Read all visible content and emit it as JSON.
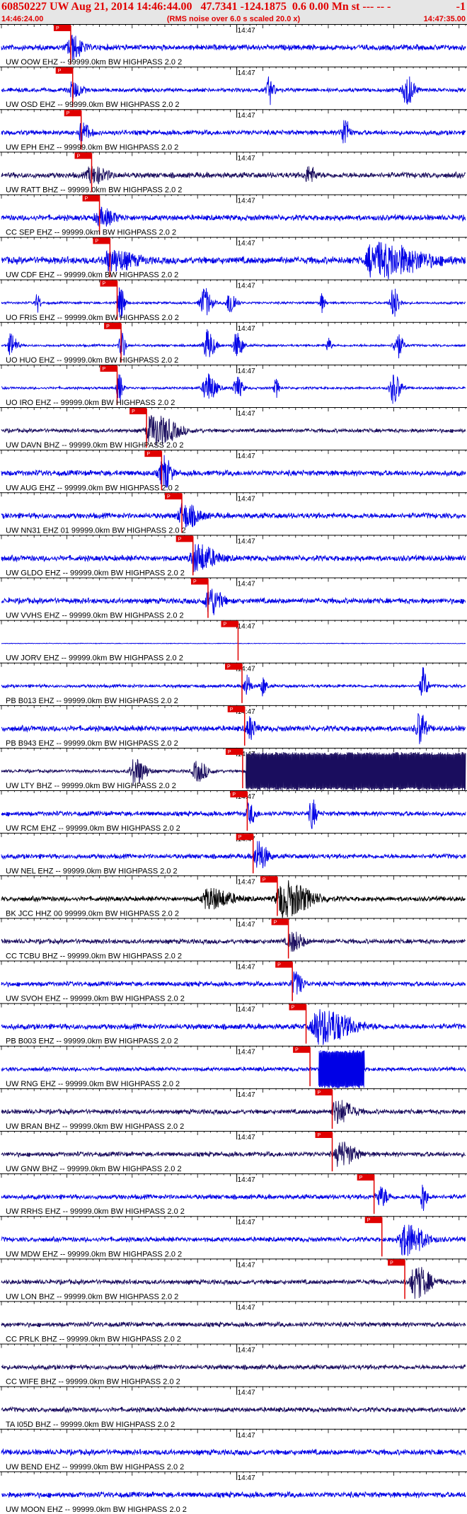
{
  "header": {
    "title": "60850227 UW Aug 21, 2014 14:46:44.00   47.7341 -124.1875  0.6 0.00 Mn st --- -- -",
    "title_right": "-1",
    "start_time": "14:46:24.00",
    "subtitle": "(RMS noise over 6.0 s scaled 20.0 x)",
    "end_time": "14:47:35.00"
  },
  "colors": {
    "trace_blue": "#0000e6",
    "trace_dark": "#1a0d5e",
    "trace_black": "#000000",
    "pick_red": "#e00000",
    "header_bg": "#e6e6e6"
  },
  "chart_data": {
    "type": "line",
    "description_kind": "seismogram record section",
    "time_start": "14:46:24.00",
    "time_end": "14:47:35.00",
    "time_range_s": [
      0,
      71
    ],
    "minute_tick_label": "14:47",
    "minute_tick_time_s": 36,
    "pick_label": "P",
    "traces": [
      {
        "label": "UW OOW EHZ -- 99999.0km BW  HIGHPASS  2.0  2",
        "pick_s": 10.6,
        "color": "blue",
        "energy": 0.35,
        "bursts": [
          [
            10.8,
            1.4,
            0.6
          ]
        ]
      },
      {
        "label": "UW OSD EHZ -- 99999.0km BW  HIGHPASS  2.0  2",
        "pick_s": 10.9,
        "color": "blue",
        "energy": 0.25,
        "bursts": [
          [
            11.0,
            1.2,
            0.4
          ],
          [
            41.0,
            0.6,
            0.7
          ],
          [
            62.0,
            1.0,
            0.8
          ]
        ]
      },
      {
        "label": "UW EPH EHZ -- 99999.0km BW  HIGHPASS  2.0  2",
        "pick_s": 12.2,
        "color": "blue",
        "energy": 0.3,
        "bursts": [
          [
            12.4,
            1.0,
            0.5
          ],
          [
            52.5,
            0.6,
            0.9
          ]
        ]
      },
      {
        "label": "UW RATT BHZ -- 99999.0km BW  HIGHPASS  2.0  2",
        "pick_s": 13.8,
        "color": "dark",
        "energy": 0.35,
        "bursts": [
          [
            14.0,
            2.0,
            0.4
          ],
          [
            47.0,
            1.0,
            0.4
          ]
        ]
      },
      {
        "label": "CC SEP EHZ -- 99999.0km BW  HIGHPASS  2.0  2",
        "pick_s": 15.0,
        "color": "blue",
        "energy": 0.35,
        "bursts": [
          [
            15.3,
            2.0,
            0.4
          ]
        ]
      },
      {
        "label": "UW CDF EHZ -- 99999.0km BW  HIGHPASS  2.0  2",
        "pick_s": 16.6,
        "color": "blue",
        "energy": 0.45,
        "bursts": [
          [
            17.0,
            3.0,
            0.5
          ],
          [
            58.0,
            6.0,
            0.8
          ]
        ]
      },
      {
        "label": "UO FRIS EHZ -- 99999.0km BW  HIGHPASS  2.0  2",
        "pick_s": 17.7,
        "color": "blue",
        "energy": 0.15,
        "bursts": [
          [
            5.5,
            0.4,
            0.5
          ],
          [
            18.2,
            0.6,
            0.9
          ],
          [
            31.0,
            1.0,
            0.8
          ],
          [
            35.0,
            0.8,
            0.7
          ],
          [
            49.0,
            0.4,
            0.5
          ],
          [
            60.0,
            0.8,
            0.8
          ]
        ]
      },
      {
        "label": "UO HUO EHZ -- 99999.0km BW  HIGHPASS  2.0  2",
        "pick_s": 18.3,
        "color": "blue",
        "energy": 0.15,
        "bursts": [
          [
            1.5,
            0.8,
            0.6
          ],
          [
            18.4,
            0.5,
            0.8
          ],
          [
            31.5,
            1.0,
            0.8
          ],
          [
            36.0,
            0.8,
            0.7
          ],
          [
            50.0,
            0.4,
            0.4
          ],
          [
            60.5,
            0.8,
            0.7
          ]
        ]
      },
      {
        "label": "UO IRO EHZ -- 99999.0km BW  HIGHPASS  2.0  2",
        "pick_s": 17.7,
        "color": "blue",
        "energy": 0.15,
        "bursts": [
          [
            18.0,
            0.5,
            0.8
          ],
          [
            31.5,
            1.2,
            0.8
          ],
          [
            36.0,
            0.8,
            0.6
          ],
          [
            42.0,
            0.4,
            0.5
          ],
          [
            60.0,
            1.0,
            0.8
          ]
        ]
      },
      {
        "label": "UW DAVN BHZ -- 99999.0km BW  HIGHPASS  2.0  2",
        "pick_s": 22.2,
        "color": "dark",
        "energy": 0.25,
        "bursts": [
          [
            23.5,
            3.0,
            0.8
          ]
        ]
      },
      {
        "label": "UW AUG EHZ -- 99999.0km BW  HIGHPASS  2.0  2",
        "pick_s": 24.5,
        "color": "blue",
        "energy": 0.35,
        "bursts": [
          [
            24.8,
            1.0,
            0.9
          ]
        ]
      },
      {
        "label": "UW NN31 EHZ 01 99999.0km BW  HIGHPASS  2.0  2",
        "pick_s": 27.6,
        "color": "blue",
        "energy": 0.35,
        "bursts": [
          [
            28.0,
            2.0,
            0.6
          ]
        ]
      },
      {
        "label": "UW GLDO EHZ -- 99999.0km BW  HIGHPASS  2.0  2",
        "pick_s": 29.3,
        "color": "blue",
        "energy": 0.35,
        "bursts": [
          [
            30.0,
            2.5,
            0.7
          ]
        ]
      },
      {
        "label": "UW VVHS EHZ -- 99999.0km BW  HIGHPASS  2.0  2",
        "pick_s": 31.6,
        "color": "blue",
        "energy": 0.35,
        "bursts": [
          [
            32.0,
            1.5,
            0.7
          ]
        ]
      },
      {
        "label": "UW JORV EHZ -- 99999.0km BW  HIGHPASS  2.0  2",
        "pick_s": 36.2,
        "color": "blue",
        "energy": 0.04,
        "bursts": []
      },
      {
        "label": "PB B013 EHZ -- 99999.0km BW  HIGHPASS  2.0  2",
        "pick_s": 36.8,
        "color": "blue",
        "energy": 0.2,
        "bursts": [
          [
            37.5,
            0.6,
            0.6
          ],
          [
            40.0,
            0.5,
            0.5
          ],
          [
            64.5,
            0.6,
            0.9
          ]
        ]
      },
      {
        "label": "PB B943 EHZ -- 99999.0km BW  HIGHPASS  2.0  2",
        "pick_s": 37.2,
        "color": "blue",
        "energy": 0.35,
        "bursts": [
          [
            38.0,
            0.8,
            0.6
          ],
          [
            64.0,
            0.8,
            0.9
          ]
        ]
      },
      {
        "label": "UW LTY BHZ -- 99999.0km BW  HIGHPASS  2.0  2",
        "pick_s": 36.9,
        "color": "dark",
        "energy": 0.2,
        "bursts": [
          [
            20.5,
            1.5,
            0.7
          ],
          [
            30.0,
            1.5,
            0.5
          ]
        ],
        "saturated_from_s": 37.4
      },
      {
        "label": "UW RCM EHZ -- 99999.0km BW  HIGHPASS  2.0  2",
        "pick_s": 37.6,
        "color": "blue",
        "energy": 0.3,
        "bursts": [
          [
            38.0,
            0.8,
            0.5
          ],
          [
            47.5,
            0.6,
            0.8
          ]
        ]
      },
      {
        "label": "UW NEL EHZ -- 99999.0km BW  HIGHPASS  2.0  2",
        "pick_s": 38.5,
        "color": "blue",
        "energy": 0.3,
        "bursts": [
          [
            39.3,
            1.2,
            0.8
          ]
        ]
      },
      {
        "label": "BK JCC HHZ 00 99999.0km BW  HIGHPASS  2.0  2",
        "pick_s": 42.2,
        "color": "black",
        "energy": 0.3,
        "bursts": [
          [
            43.5,
            3.5,
            0.9
          ],
          [
            32.0,
            3.0,
            0.5
          ]
        ]
      },
      {
        "label": "CC TCBU BHZ -- 99999.0km BW  HIGHPASS  2.0  2",
        "pick_s": 43.9,
        "color": "dark",
        "energy": 0.3,
        "bursts": [
          [
            44.5,
            1.5,
            0.5
          ]
        ]
      },
      {
        "label": "UW SVOH EHZ -- 99999.0km BW  HIGHPASS  2.0  2",
        "pick_s": 44.5,
        "color": "blue",
        "energy": 0.3,
        "bursts": [
          [
            45.0,
            1.0,
            0.6
          ]
        ]
      },
      {
        "label": "PB B003 EHZ -- 99999.0km BW  HIGHPASS  2.0  2",
        "pick_s": 46.6,
        "color": "blue",
        "energy": 0.35,
        "bursts": [
          [
            49.0,
            4.0,
            0.9
          ]
        ]
      },
      {
        "label": "UW RNG EHZ -- 99999.0km BW  HIGHPASS  2.0  2",
        "pick_s": 47.2,
        "color": "blue",
        "energy": 0.25,
        "bursts": [],
        "saturated_from_s": 48.5,
        "saturated_to_s": 55.5
      },
      {
        "label": "UW BRAN BHZ -- 99999.0km BW  HIGHPASS  2.0  2",
        "pick_s": 50.6,
        "color": "dark",
        "energy": 0.3,
        "bursts": [
          [
            51.5,
            2.0,
            0.6
          ]
        ]
      },
      {
        "label": "UW GNW BHZ -- 99999.0km BW  HIGHPASS  2.0  2",
        "pick_s": 50.6,
        "color": "dark",
        "energy": 0.3,
        "bursts": [
          [
            52.0,
            2.0,
            0.6
          ]
        ]
      },
      {
        "label": "UW RRHS EHZ -- 99999.0km BW  HIGHPASS  2.0  2",
        "pick_s": 57.0,
        "color": "blue",
        "energy": 0.3,
        "bursts": [
          [
            58.0,
            1.0,
            0.5
          ],
          [
            64.5,
            0.5,
            0.8
          ]
        ]
      },
      {
        "label": "UW MDW EHZ -- 99999.0km BW  HIGHPASS  2.0  2",
        "pick_s": 58.2,
        "color": "blue",
        "energy": 0.3,
        "bursts": [
          [
            62.0,
            2.5,
            0.8
          ]
        ]
      },
      {
        "label": "UW LON BHZ -- 99999.0km BW  HIGHPASS  2.0  2",
        "pick_s": 61.7,
        "color": "dark",
        "energy": 0.3,
        "bursts": [
          [
            63.5,
            2.0,
            0.8
          ]
        ]
      },
      {
        "label": "CC PRLK BHZ -- 99999.0km BW  HIGHPASS  2.0  2",
        "color": "dark",
        "energy": 0.3,
        "bursts": []
      },
      {
        "label": "CC WIFE BHZ -- 99999.0km BW  HIGHPASS  2.0  2",
        "color": "dark",
        "energy": 0.3,
        "bursts": []
      },
      {
        "label": "TA I05D BHZ -- 99999.0km BW  HIGHPASS  2.0  2",
        "color": "dark",
        "energy": 0.3,
        "bursts": []
      },
      {
        "label": "UW BEND EHZ -- 99999.0km BW  HIGHPASS  2.0  2",
        "color": "blue",
        "energy": 0.35,
        "bursts": []
      },
      {
        "label": "UW MOON EHZ -- 99999.0km BW  HIGHPASS  2.0  2",
        "color": "blue",
        "energy": 0.35,
        "bursts": []
      }
    ]
  }
}
